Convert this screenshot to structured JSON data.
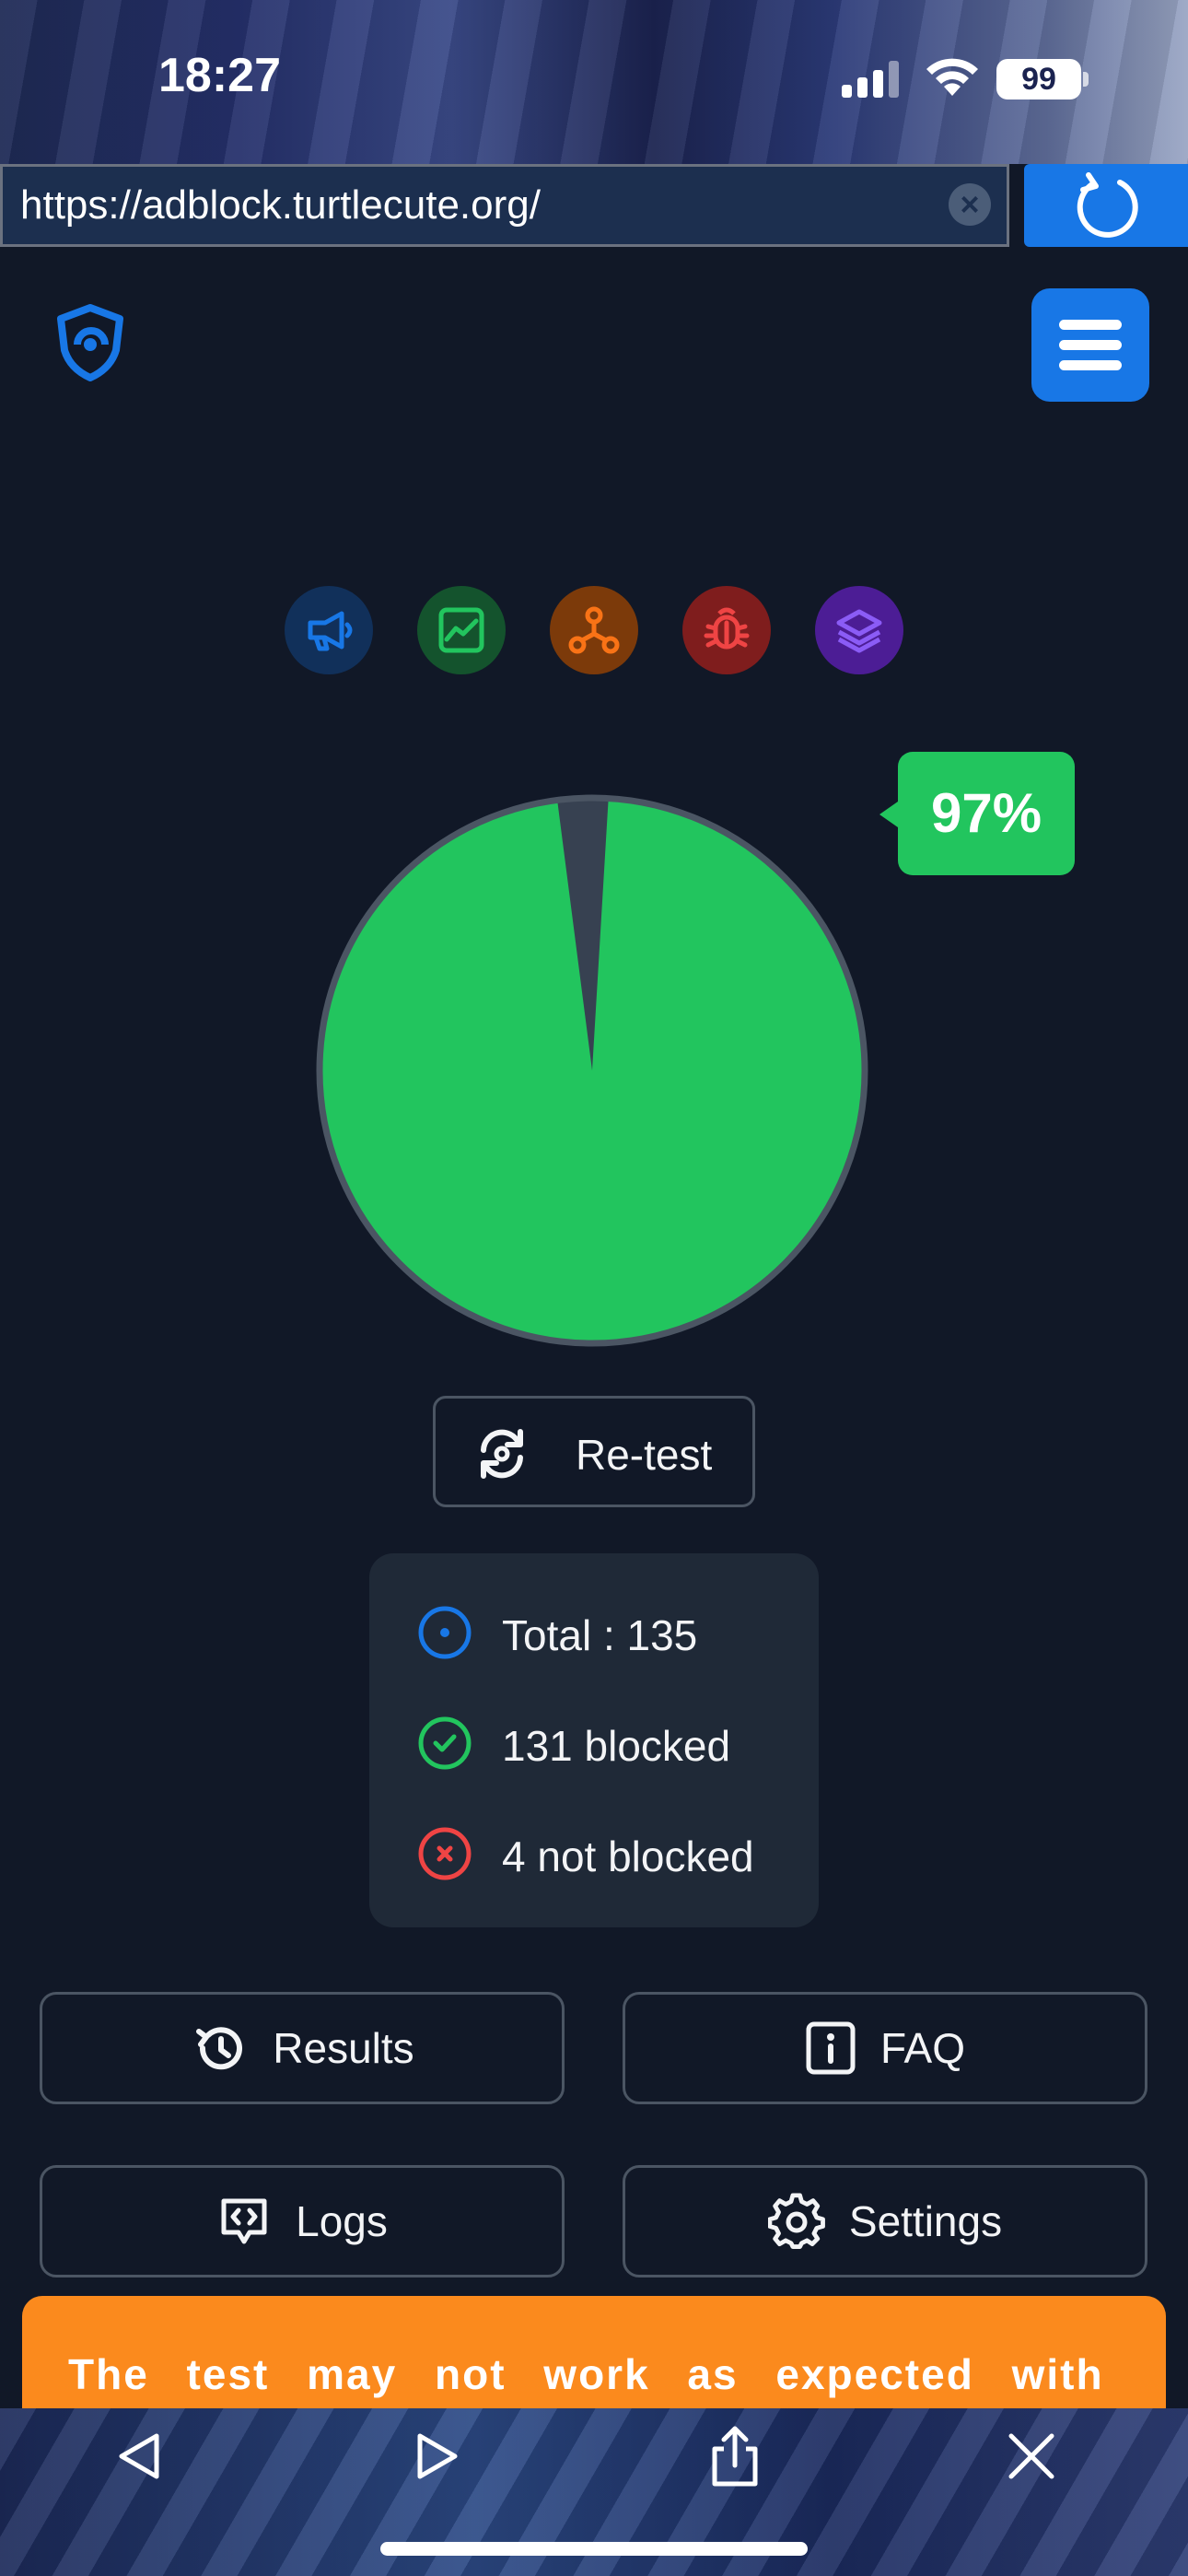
{
  "status_bar": {
    "time": "18:27",
    "battery": "99"
  },
  "browser": {
    "url": "https://adblock.turtlecute.org/",
    "clear_label": "×"
  },
  "categories": [
    {
      "name": "ads",
      "icon": "megaphone-icon",
      "color": "#1877e6"
    },
    {
      "name": "analytics",
      "icon": "chart-icon",
      "color": "#22c55e"
    },
    {
      "name": "social",
      "icon": "network-icon",
      "color": "#f97316"
    },
    {
      "name": "error-monitoring",
      "icon": "bug-icon",
      "color": "#ef4444"
    },
    {
      "name": "mix",
      "icon": "layers-icon",
      "color": "#8b5cf6"
    }
  ],
  "score": {
    "percent_label": "97%",
    "blocked_fraction": 0.97,
    "fill_color": "#22c55e"
  },
  "retest": {
    "label": "Re-test"
  },
  "stats": {
    "total": "Total : 135",
    "blocked": "131 blocked",
    "not_blocked": "4 not blocked"
  },
  "actions": {
    "results": "Results",
    "faq": "FAQ",
    "logs": "Logs",
    "settings": "Settings"
  },
  "warning": {
    "text": "The test may not work as expected with"
  }
}
